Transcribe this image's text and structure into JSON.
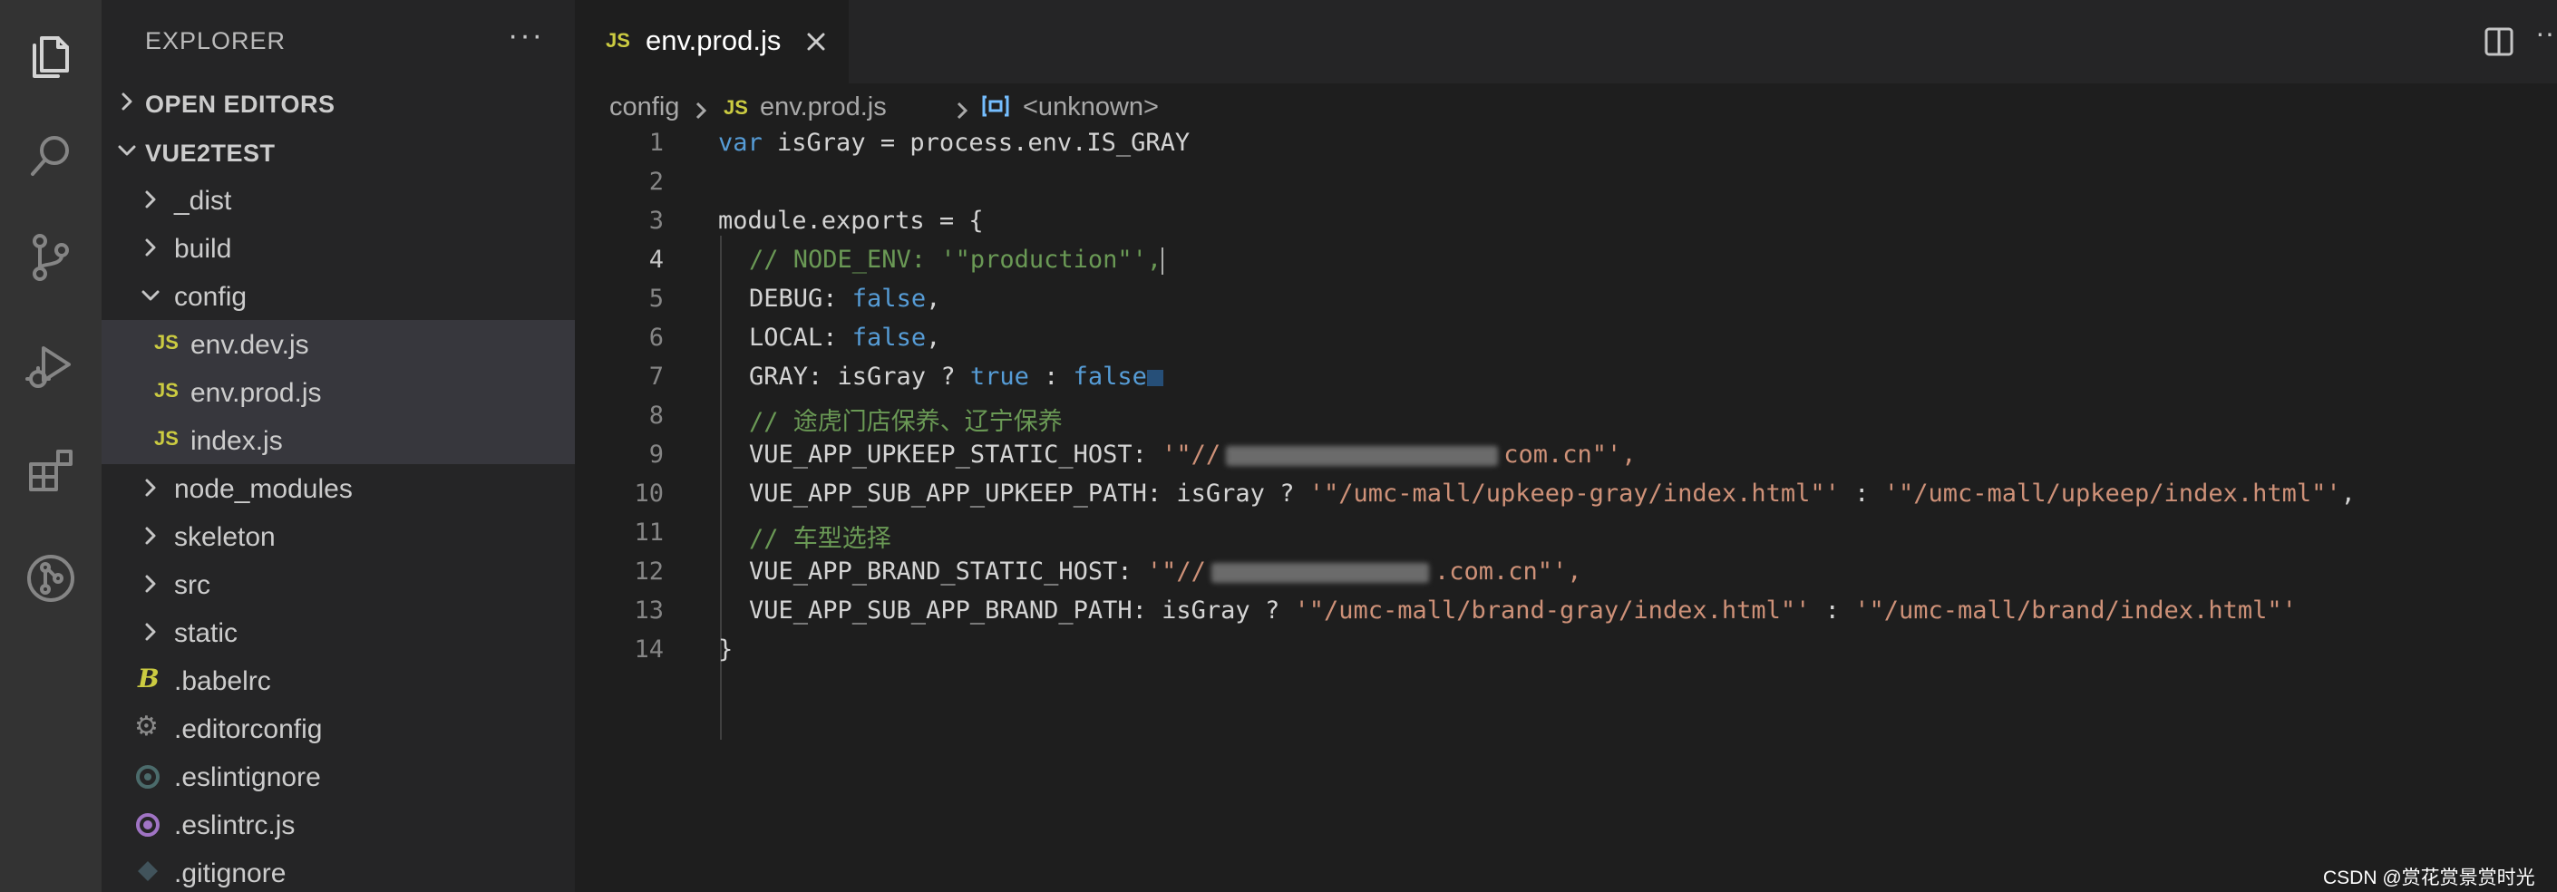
{
  "sidebar": {
    "title": "EXPLORER",
    "more": "···",
    "sections": {
      "open_editors": "OPEN EDITORS",
      "project": "VUE2TEST"
    },
    "tree": [
      {
        "name": "_dist",
        "type": "folder"
      },
      {
        "name": "build",
        "type": "folder"
      },
      {
        "name": "config",
        "type": "folder-open"
      },
      {
        "name": "env.dev.js",
        "type": "js"
      },
      {
        "name": "env.prod.js",
        "type": "js"
      },
      {
        "name": "index.js",
        "type": "js"
      },
      {
        "name": "node_modules",
        "type": "folder"
      },
      {
        "name": "skeleton",
        "type": "folder"
      },
      {
        "name": "src",
        "type": "folder"
      },
      {
        "name": "static",
        "type": "folder"
      },
      {
        "name": ".babelrc",
        "type": "babel"
      },
      {
        "name": ".editorconfig",
        "type": "gear"
      },
      {
        "name": ".eslintignore",
        "type": "eslint"
      },
      {
        "name": ".eslintrc.js",
        "type": "eslint-js"
      },
      {
        "name": ".gitignore",
        "type": "git"
      }
    ],
    "js_badge": "JS",
    "babel_badge": "B"
  },
  "editor": {
    "tab": {
      "label": "env.prod.js",
      "badge": "JS"
    },
    "breadcrumb": {
      "folder": "config",
      "file": "env.prod.js",
      "symbol": "<unknown>"
    },
    "lines": [
      "1",
      "2",
      "3",
      "4",
      "5",
      "6",
      "7",
      "8",
      "9",
      "10",
      "11",
      "12",
      "13",
      "14"
    ],
    "code": {
      "l1_kw": "var",
      "l1_rest": " isGray = process.env.IS_GRAY",
      "l3": "module.exports = {",
      "l4": "// NODE_ENV: '\"production\"',",
      "l5_key": "DEBUG: ",
      "l5_val": "false",
      "l6_key": "LOCAL: ",
      "l6_val": "false",
      "l7_key": "GRAY: isGray ? ",
      "l7_true": "true",
      "l7_mid": " : ",
      "l7_false": "false",
      "l8": "// 途虎门店保养、辽宁保养",
      "l9_key": "VUE_APP_UPKEEP_STATIC_HOST: ",
      "l9_pre": "'\"//",
      "l9_post": "com.cn\"',",
      "l10_key": "VUE_APP_SUB_APP_UPKEEP_PATH: isGray ? ",
      "l10_s1": "'\"/umc-mall/upkeep-gray/index.html\"'",
      "l10_mid": " : ",
      "l10_s2": "'\"/umc-mall/upkeep/index.html\"'",
      "l10_end": ",",
      "l11": "// 车型选择",
      "l12_key": "VUE_APP_BRAND_STATIC_HOST: ",
      "l12_pre": "'\"//",
      "l12_post": ".com.cn\"',",
      "l13_key": "VUE_APP_SUB_APP_BRAND_PATH: isGray ? ",
      "l13_s1": "'\"/umc-mall/brand-gray/index.html\"'",
      "l13_mid": " : ",
      "l13_s2": "'\"/umc-mall/brand/index.html\"'",
      "l14": "}"
    }
  },
  "watermark": "CSDN @赏花赏景赏时光",
  "colors": {
    "activity_bar": "#333333",
    "sidebar": "#252526",
    "editor": "#1e1e1e",
    "keyword": "#569cd6",
    "string": "#ce9178",
    "comment": "#6a9955",
    "js_badge": "#cbcb41"
  },
  "icons": [
    "explorer-icon",
    "search-icon",
    "source-control-icon",
    "run-debug-icon",
    "extensions-icon",
    "git-graph-icon",
    "split-editor-icon",
    "close-icon",
    "chevron-right-icon",
    "chevron-down-icon"
  ]
}
